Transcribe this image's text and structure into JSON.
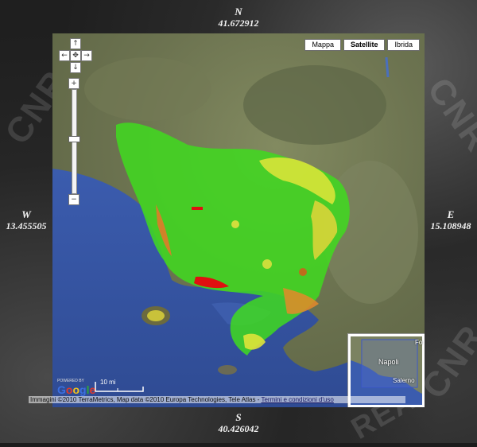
{
  "coords": {
    "north": {
      "label": "N",
      "value": "41.672912"
    },
    "south": {
      "label": "S",
      "value": "40.426042"
    },
    "west": {
      "label": "W",
      "value": "13.455505"
    },
    "east": {
      "label": "E",
      "value": "15.108948"
    }
  },
  "map_types": [
    {
      "label": "Mappa",
      "active": false
    },
    {
      "label": "Satellite",
      "active": true
    },
    {
      "label": "Ibrida",
      "active": false
    }
  ],
  "watermark": {
    "cnr": "CNR",
    "rea": "REA"
  },
  "zoom_level": 0.52,
  "scale_label": "10 mi",
  "logo": {
    "text": "Google",
    "powered_by": "POWERED BY"
  },
  "minimap": {
    "city": "Napoli",
    "other": "Salerno",
    "corner": "Fo"
  },
  "attribution": {
    "text": "Immagini ©2010 TerraMetrics, Map data ©2010 Europa Technologies, Tele Atlas - ",
    "terms_link": "Termini e condizioni d'uso"
  },
  "colors": {
    "sea": "#3a5aa8",
    "land": "#6e7552",
    "high": "#33e818",
    "mid": "#e8e23a",
    "low": "#e01010"
  },
  "icons": [
    "pan-up-icon",
    "pan-left-icon",
    "pan-center-icon",
    "pan-right-icon",
    "pan-down-icon",
    "zoom-in-icon",
    "zoom-out-icon"
  ]
}
